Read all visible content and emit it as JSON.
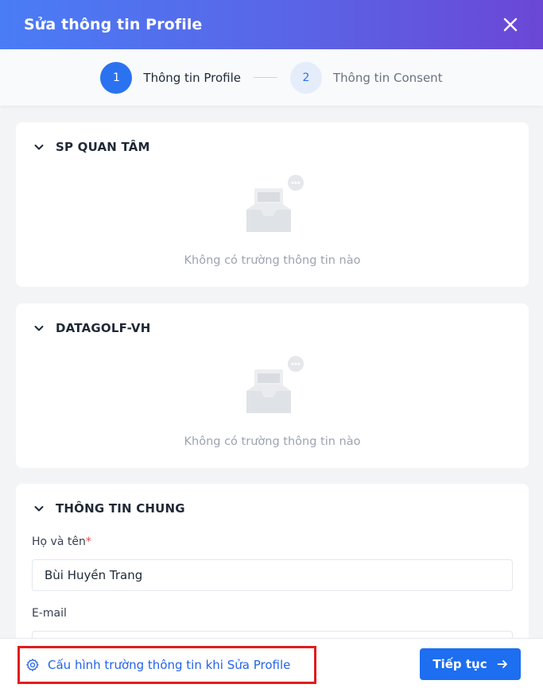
{
  "dialog": {
    "title": "Sửa thông tin Profile"
  },
  "stepper": {
    "steps": [
      {
        "number": "1",
        "label": "Thông tin Profile"
      },
      {
        "number": "2",
        "label": "Thông tin Consent"
      }
    ],
    "active_step": 1
  },
  "sections": [
    {
      "title": "SP QUAN TÂM",
      "empty_text": "Không có trường thông tin nào"
    },
    {
      "title": "DATAGOLF-VH",
      "empty_text": "Không có trường thông tin nào"
    },
    {
      "title": "THÔNG TIN CHUNG",
      "fields": [
        {
          "label": "Họ và tên",
          "required_mark": "*",
          "value": "Bùi Huyền Trang"
        },
        {
          "label": "E-mail",
          "value": ""
        }
      ]
    }
  ],
  "footer": {
    "config_link": "Cấu hình trường thông tin khi Sửa Profile",
    "next_label": "Tiếp tục"
  },
  "colors": {
    "primary": "#1d6ef0",
    "header_start": "#4a7cf6",
    "header_end": "#6b47d6",
    "highlight": "#e11d1d"
  },
  "icons": [
    "close-icon",
    "chevron-down-icon",
    "empty-inbox-icon",
    "gear-icon",
    "arrow-right-icon"
  ]
}
